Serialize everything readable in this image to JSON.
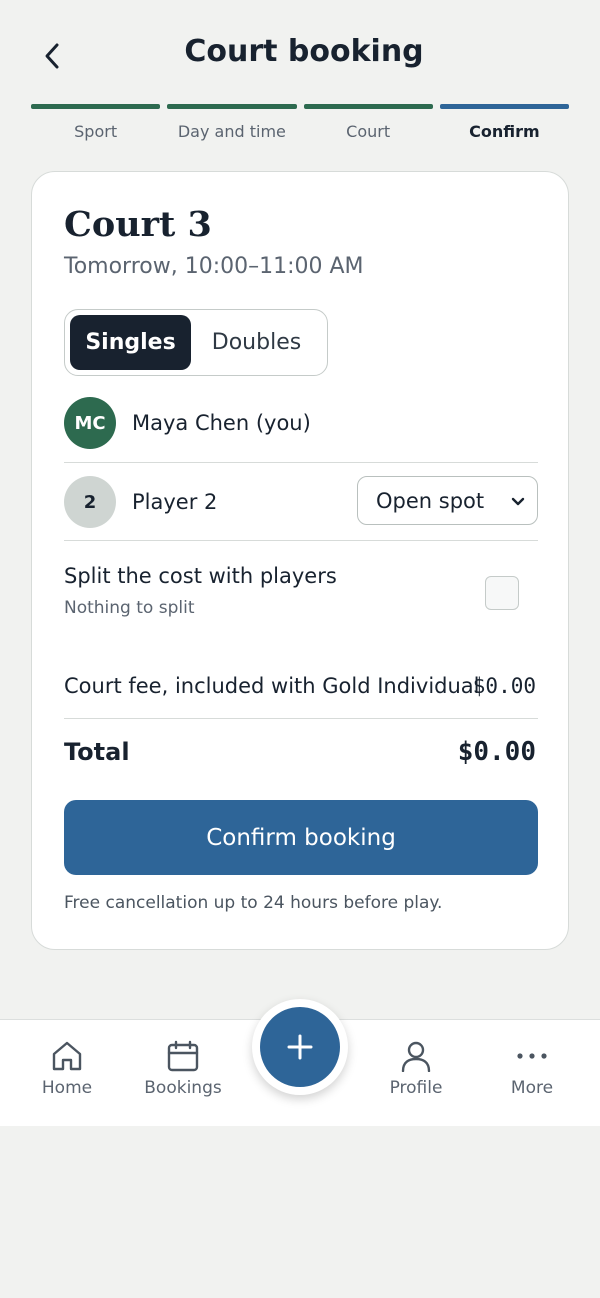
{
  "header": {
    "title": "Court booking",
    "back_icon": "chevron-left-icon"
  },
  "steps": [
    {
      "label": "Sport",
      "status": "done",
      "color": "#2d6a4f"
    },
    {
      "label": "Day and time",
      "status": "done",
      "color": "#2d6a4f"
    },
    {
      "label": "Court",
      "status": "done",
      "color": "#2d6a4f"
    },
    {
      "label": "Confirm",
      "status": "active",
      "color": "#2e6598"
    }
  ],
  "booking": {
    "court": "Court 3",
    "time": "Tomorrow, 10:00–11:00 AM",
    "format_options": [
      "Singles",
      "Doubles"
    ],
    "format_selected": "Singles",
    "players": [
      {
        "initials": "MC",
        "name": "Maya Chen (you)"
      },
      {
        "initials": "2",
        "name": "Player 2",
        "select_value": "Open spot"
      }
    ],
    "split": {
      "title": "Split the cost with players",
      "subtitle": "Nothing to split",
      "checked": false
    },
    "fee_label": "Court fee, included with Gold Individual",
    "fee_amount": "$0.00",
    "total_label": "Total",
    "total_amount": "$0.00",
    "confirm_label": "Confirm booking",
    "cancellation_note": "Free cancellation up to 24 hours before play."
  },
  "tabbar": {
    "items": [
      {
        "label": "Home",
        "icon": "home-icon"
      },
      {
        "label": "Bookings",
        "icon": "calendar-icon"
      },
      {
        "label": "Profile",
        "icon": "user-icon"
      },
      {
        "label": "More",
        "icon": "more-icon"
      }
    ],
    "fab_icon": "plus-icon"
  },
  "colors": {
    "primary": "#2e6598",
    "progress_done": "#2d6a4f",
    "dark": "#18222f",
    "avatar_user": "#2d6a4f",
    "avatar_open": "#cfd5d2"
  }
}
